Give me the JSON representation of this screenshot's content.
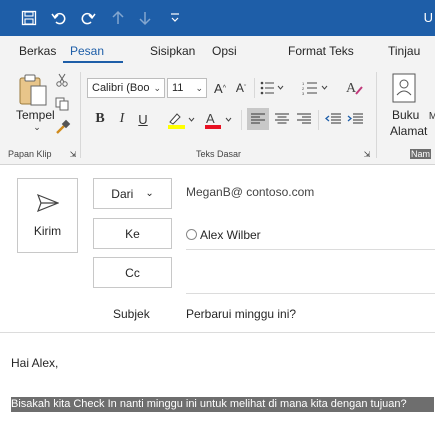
{
  "titlebar": {
    "right_text": "U"
  },
  "tabs": [
    {
      "label": "Berkas"
    },
    {
      "label": "Pesan"
    },
    {
      "label": "Sisipkan"
    },
    {
      "label": "Opsi"
    },
    {
      "label": "Format Teks"
    },
    {
      "label": "Tinjau"
    }
  ],
  "ribbon": {
    "clipboard": {
      "paste_label": "Tempel",
      "group_label": "Papan Klip"
    },
    "basic_text": {
      "font_name": "Calibri (Boo",
      "font_size": "11",
      "group_label": "Teks Dasar"
    },
    "names": {
      "address_book_label_1": "Buku",
      "address_book_label_2": "Alamat",
      "group_label": "Nam"
    }
  },
  "compose": {
    "send_label": "Kirim",
    "from_label": "Dari",
    "from_value": "MeganB@ contoso.com",
    "to_label": "Ke",
    "to_value": "Alex Wilber",
    "cc_label": "Cc",
    "subject_label": "Subjek",
    "subject_value": "Perbarui minggu ini?"
  },
  "body": {
    "greeting": "Hai Alex,",
    "selected_line": "Bisakah kita Check In nanti minggu ini untuk melihat di mana kita dengan tujuan?"
  },
  "colors": {
    "accent": "#1e5ea8",
    "highlight": "#ffff00",
    "font_color": "#e81123",
    "selection": "#6e6e6e"
  }
}
